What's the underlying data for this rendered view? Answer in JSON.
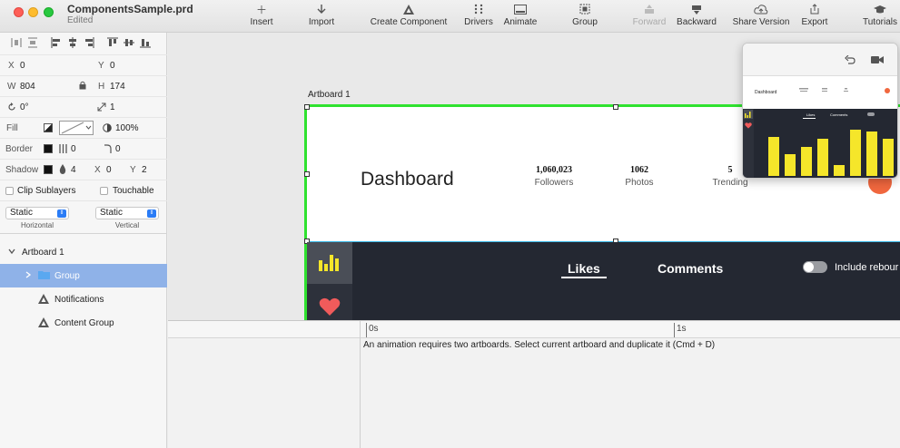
{
  "window": {
    "document_name": "ComponentsSample.prd",
    "status": "Edited"
  },
  "toolbar": {
    "insert": "Insert",
    "import": "Import",
    "create_component": "Create Component",
    "drivers": "Drivers",
    "animate": "Animate",
    "group": "Group",
    "forward": "Forward",
    "backward": "Backward",
    "share_version": "Share Version",
    "export": "Export",
    "tutorials": "Tutorials"
  },
  "inspector": {
    "x_label": "X",
    "x_value": "0",
    "y_label": "Y",
    "y_value": "0",
    "w_label": "W",
    "w_value": "804",
    "h_label": "H",
    "h_value": "174",
    "rotation": "0°",
    "scale": "1",
    "fill_label": "Fill",
    "fill_opacity": "100%",
    "border_label": "Border",
    "border_width": "0",
    "border_radius": "0",
    "shadow_label": "Shadow",
    "shadow_blur": "4",
    "shadow_x_label": "X",
    "shadow_x": "0",
    "shadow_y_label": "Y",
    "shadow_y": "2",
    "clip_sublayers": "Clip Sublayers",
    "touchable": "Touchable",
    "horizontal_value": "Static",
    "horizontal_label": "Horizontal",
    "vertical_value": "Static",
    "vertical_label": "Vertical"
  },
  "layers": {
    "artboard": "Artboard 1",
    "group": "Group",
    "notifications": "Notifications",
    "content_group": "Content Group"
  },
  "canvas": {
    "artboard_label": "Artboard 1",
    "dashboard_title": "Dashboard",
    "stats": [
      {
        "value": "1,060,023",
        "label": "Followers"
      },
      {
        "value": "1062",
        "label": "Photos"
      },
      {
        "value": "5",
        "label": "Trending"
      }
    ],
    "tab_likes": "Likes",
    "tab_comments": "Comments",
    "toggle_label": "Include rebour"
  },
  "preview": {
    "dashboard_title": "Dashboard",
    "tab_likes": "Likes",
    "tab_comments": "Comments",
    "bar_values": [
      0.8,
      0.45,
      0.6,
      0.75,
      0.22,
      0.95,
      0.9,
      0.75
    ],
    "bar_color": "#f5e62a"
  },
  "timeline": {
    "tick_0": "0s",
    "tick_1": "1s",
    "message": "An animation requires two artboards. Select current artboard and duplicate it (Cmd + D)"
  },
  "colors": {
    "selection_green": "#2fe22f",
    "dark_panel": "#242832",
    "accent_yellow": "#f5e62a",
    "heart_red": "#f05b5b",
    "layer_selected": "#8fb2e8"
  }
}
